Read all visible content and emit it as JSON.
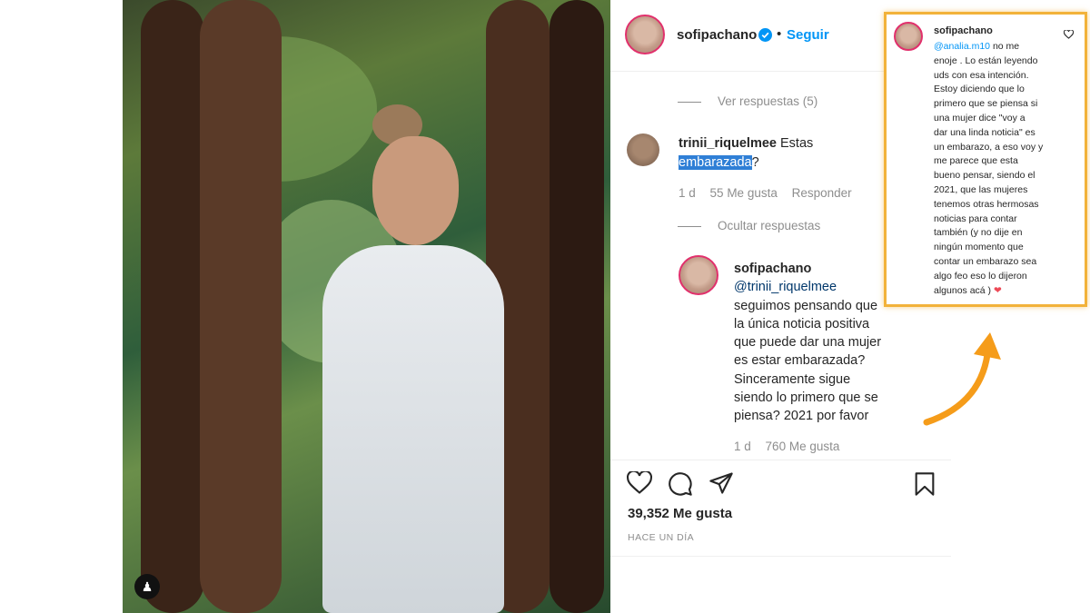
{
  "header": {
    "username": "sofipachano",
    "dot": "•",
    "follow_label": "Seguir"
  },
  "thread": {
    "view_replies_label": "Ver respuestas (5)",
    "comment": {
      "username": "trinii_riquelmee",
      "text_before": "Estas",
      "highlighted": "embarazada",
      "text_after": "?",
      "time": "1 d",
      "likes": "55 Me gusta",
      "reply_label": "Responder"
    },
    "hide_replies_label": "Ocultar respuestas",
    "reply": {
      "username": "sofipachano",
      "mention": "@trinii_riquelmee",
      "lines": [
        "seguimos pensando que",
        "la única noticia positiva",
        "que puede dar una mujer",
        "es estar embarazada?",
        "Sinceramente sigue",
        "siendo lo primero que se",
        "piensa? 2021 por favor"
      ],
      "time": "1 d",
      "likes": "760 Me gusta"
    }
  },
  "actions": {
    "likes_count": "39,352 Me gusta",
    "posted_ago": "HACE UN DÍA"
  },
  "callout": {
    "username": "sofipachano",
    "mention": "@analia.m10",
    "lines": [
      "no me",
      "enoje . Lo están leyendo",
      "uds con esa intención.",
      "Estoy diciendo que lo",
      "primero que se piensa si",
      "una mujer dice \"voy a",
      "dar una linda noticia\" es",
      "un embarazo, a eso voy y",
      "me parece que esta",
      "bueno pensar, siendo el",
      "2021, que las mujeres",
      "tenemos otras hermosas",
      "noticias para contar",
      "también (y no dije en",
      "ningún momento que",
      "contar un embarazo sea",
      "algo feo eso lo dijeron",
      "algunos acá )"
    ],
    "heart": "❤"
  },
  "colors": {
    "accent_blue": "#0095f6",
    "highlight": "#2f7fd6",
    "callout_border": "#f2b23a",
    "arrow": "#f59c1a",
    "heart": "#ed4956"
  }
}
